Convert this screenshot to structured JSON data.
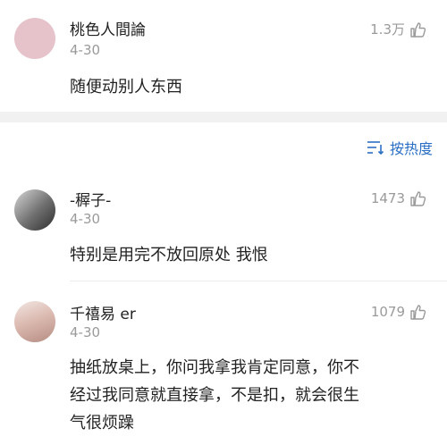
{
  "top_comment": {
    "username": "桃色人間論",
    "date": "4-30",
    "likes": "1.3万",
    "text": "随便动别人东西"
  },
  "sort": {
    "label": "按热度"
  },
  "comments": [
    {
      "username": "-稺子-",
      "date": "4-30",
      "likes": "1473",
      "text": "特别是用完不放回原处 我恨"
    },
    {
      "username": "千禧易 er",
      "date": "4-30",
      "likes": "1079",
      "text_lines": [
        "抽纸放桌上，你问我拿我肯定同意，你不",
        "经过我同意就直接拿，不是扣，就会很生",
        "气很烦躁"
      ]
    }
  ],
  "colors": {
    "accent": "#2a6fc4",
    "muted": "#9a9a9a",
    "separator": "#f1f1f1"
  }
}
